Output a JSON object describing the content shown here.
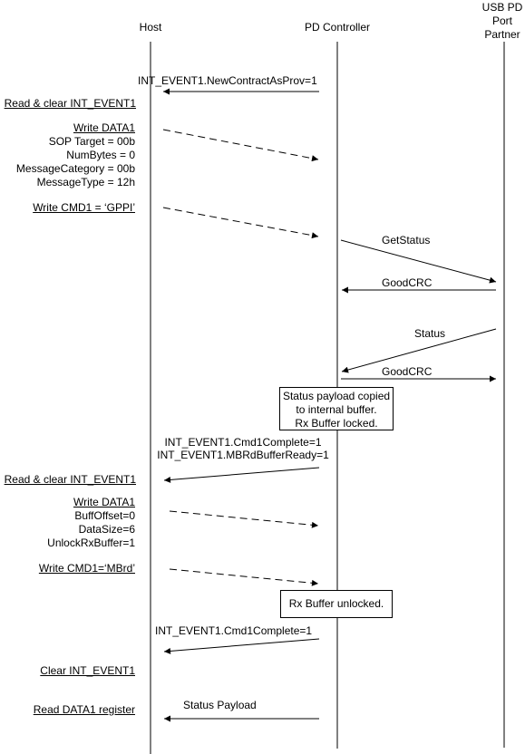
{
  "participants": {
    "host": "Host",
    "pd_controller": "PD Controller",
    "partner": [
      "USB PD",
      "Port",
      "Partner"
    ]
  },
  "messages": {
    "new_contract": "INT_EVENT1.NewContractAsProv=1",
    "get_status": "GetStatus",
    "goodcrc_1": "GoodCRC",
    "status": "Status",
    "goodcrc_2": "GoodCRC",
    "cmd1_complete_mbrd": [
      "INT_EVENT1.Cmd1Complete=1",
      "INT_EVENT1.MBRdBufferReady=1"
    ],
    "cmd1_complete": "INT_EVENT1.Cmd1Complete=1",
    "status_payload": "Status Payload"
  },
  "host_actions": {
    "read_clear_1": "Read & clear INT_EVENT1",
    "write_data1_a": {
      "title": "Write DATA1",
      "lines": [
        "SOP Target = 00b",
        "NumBytes = 0",
        "MessageCategory = 00b",
        "MessageType = 12h"
      ]
    },
    "write_cmd1_gppi": "Write CMD1 = ‘GPPI’",
    "read_clear_2": "Read & clear INT_EVENT1",
    "write_data1_b": {
      "title": "Write DATA1",
      "lines": [
        "BuffOffset=0",
        "DataSize=6",
        "UnlockRxBuffer=1"
      ]
    },
    "write_cmd1_mbrd": "Write CMD1=‘MBrd’",
    "clear": "Clear INT_EVENT1",
    "read_data1": "Read DATA1 register"
  },
  "notes": {
    "payload_copied": [
      "Status payload copied",
      "to internal buffer.",
      "Rx Buffer locked."
    ],
    "rx_unlocked": "Rx Buffer unlocked."
  }
}
